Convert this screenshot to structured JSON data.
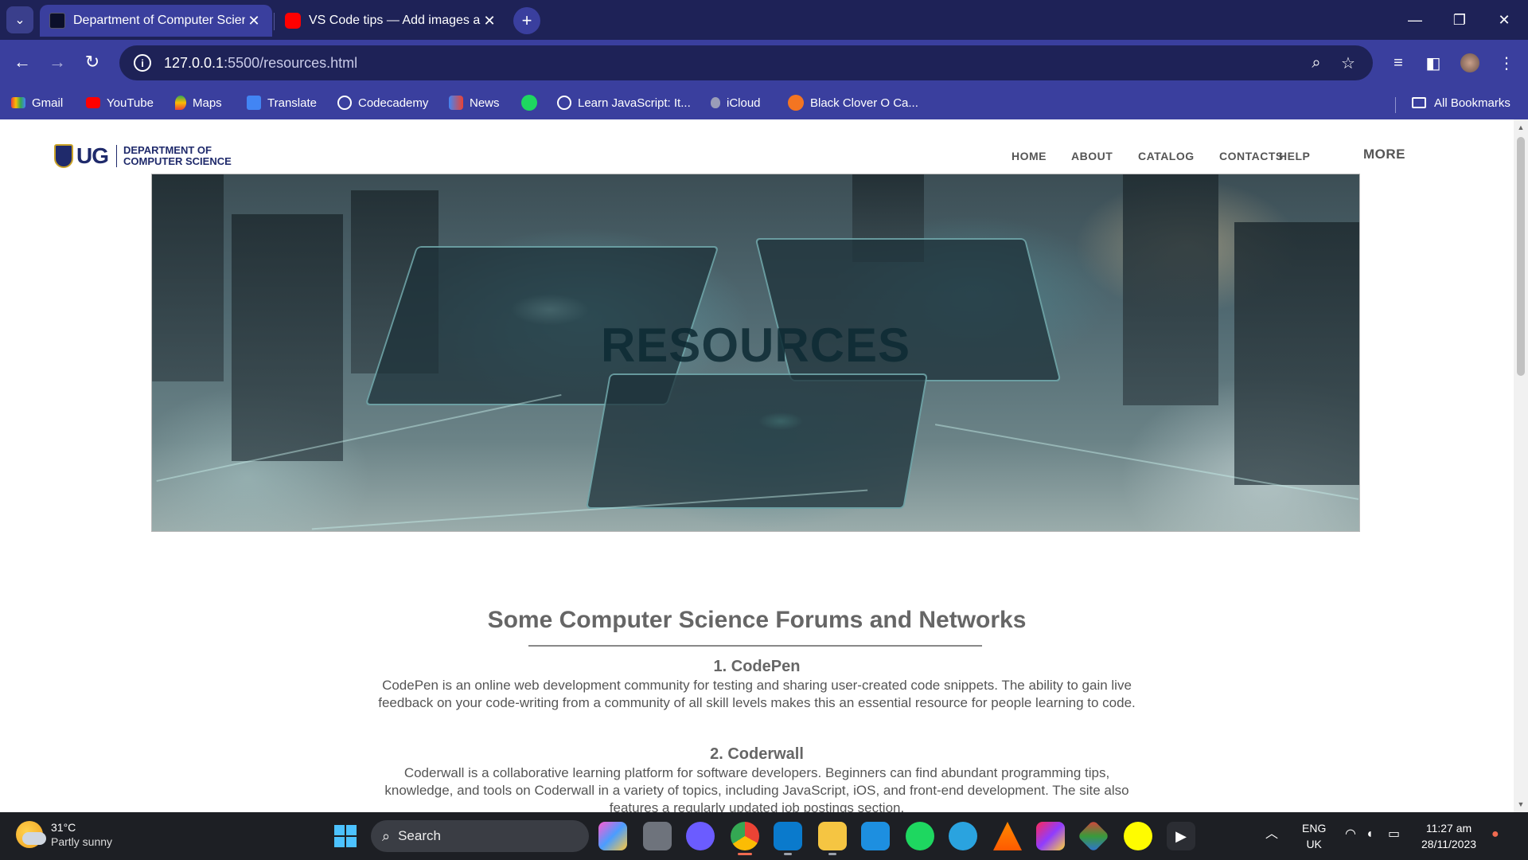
{
  "browser": {
    "tabs": [
      {
        "title": "Department of Computer Science",
        "active": true
      },
      {
        "title": "VS Code tips — Add images and",
        "active": false
      }
    ],
    "url_host": "127.0.0.1",
    "url_path": ":5500/resources.html",
    "bookmarks": [
      {
        "label": "Gmail",
        "icon": "gmail-icon"
      },
      {
        "label": "YouTube",
        "icon": "youtube-icon"
      },
      {
        "label": "Maps",
        "icon": "maps-icon"
      },
      {
        "label": "Translate",
        "icon": "translate-icon"
      },
      {
        "label": "Codecademy",
        "icon": "globe-icon"
      },
      {
        "label": "News",
        "icon": "news-icon"
      },
      {
        "label": "",
        "icon": "spotify-icon"
      },
      {
        "label": "Learn JavaScript: It...",
        "icon": "globe-icon"
      },
      {
        "label": "iCloud",
        "icon": "apple-icon"
      },
      {
        "label": "Black Clover O Ca...",
        "icon": "crunchyroll-icon"
      }
    ],
    "all_bookmarks": "All Bookmarks"
  },
  "site": {
    "logo_ug": "UG",
    "logo_dept_line1": "DEPARTMENT OF",
    "logo_dept_line2": "COMPUTER SCIENCE",
    "nav": [
      "HOME",
      "ABOUT",
      "CATALOG",
      "CONTACTS",
      "HELP",
      "MORE"
    ],
    "hero_title": "RESOURCES",
    "section_title": "Some Computer Science Forums and Networks",
    "items": [
      {
        "title": "1. CodePen",
        "body": "CodePen is an online web development community for testing and sharing user-created code snippets. The ability to gain live feedback on your code-writing from a community of all skill levels makes this an essential resource for people learning to code."
      },
      {
        "title": "2. Coderwall",
        "body": "Coderwall is a collaborative learning platform for software developers. Beginners can find abundant programming tips, knowledge, and tools on Coderwall in a variety of topics, including JavaScript, iOS, and front-end development. The site also features a regularly updated job postings section."
      }
    ]
  },
  "taskbar": {
    "weather_temp": "31°C",
    "weather_desc": "Partly sunny",
    "search_label": "Search",
    "lang_line1": "ENG",
    "lang_line2": "UK",
    "time": "11:27 am",
    "date": "28/11/2023"
  },
  "colors": {
    "chrome_dark": "#1e2257",
    "chrome_accent": "#3a3f9e",
    "brand_navy": "#1f2a6b",
    "taskbar": "#1d1f24"
  }
}
